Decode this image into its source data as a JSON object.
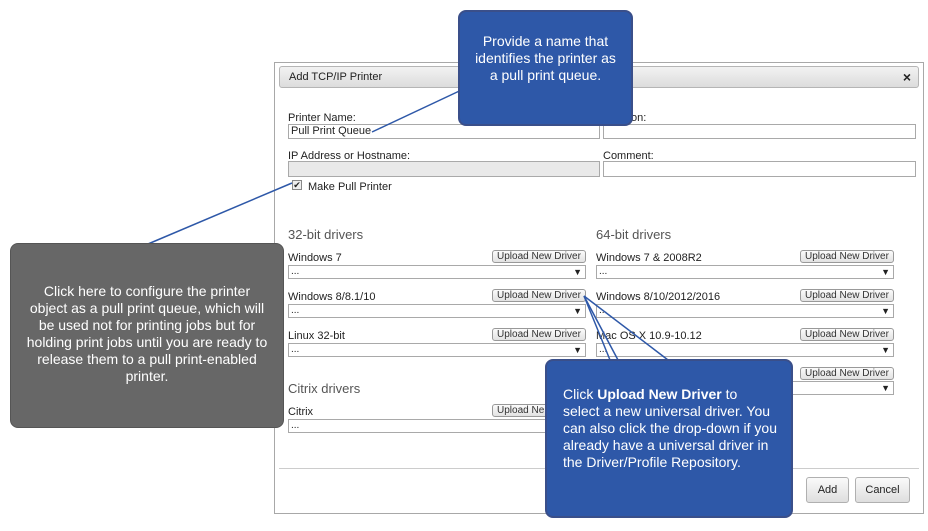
{
  "dialog": {
    "title": "Add TCP/IP Printer",
    "close_icon": "×",
    "printer_name_label": "Printer Name:",
    "printer_name_value": "Pull Print Queue",
    "location_label_partial": "on:",
    "ip_label": "IP Address or Hostname:",
    "ip_value": "",
    "comment_label": "Comment:",
    "comment_value": "",
    "make_pull_label": "Make Pull Printer",
    "make_pull_checked": true
  },
  "drivers": {
    "upload_label": "Upload New Driver",
    "upload_label_partial": "Upload Ne",
    "select_placeholder": "...",
    "select_arrow": "▼",
    "group32": {
      "title": "32-bit drivers",
      "items": [
        "Windows 7",
        "Windows 8/8.1/10",
        "Linux 32-bit"
      ]
    },
    "group64": {
      "title": "64-bit drivers",
      "items": [
        "Windows 7 & 2008R2",
        "Windows 8/10/2012/2016",
        "Mac OS X 10.9-10.12"
      ]
    },
    "citrix": {
      "title": "Citrix drivers",
      "items": [
        "Citrix"
      ]
    }
  },
  "footer": {
    "add_label": "Add",
    "cancel_label": "Cancel"
  },
  "callouts": {
    "name": "Provide a name that identifies the printer as a pull print queue.",
    "pull": "Click here to configure the printer object as a pull print queue, which will be used not for printing jobs but for holding print jobs until you are ready to release them to a pull print-enabled printer.",
    "upload_bold": "Upload New Driver",
    "upload_before": "Click ",
    "upload_after": " to select a new universal driver. You can also click the drop-down if you already have a universal driver in the Driver/Profile Repository."
  },
  "colors": {
    "callout_blue": "#2e58a8",
    "callout_gray": "#676767"
  }
}
